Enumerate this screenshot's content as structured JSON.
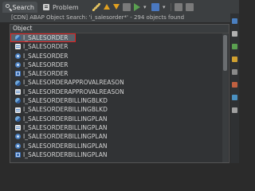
{
  "tabs": [
    {
      "label": "Search",
      "icon": "search-icon"
    },
    {
      "label": "Problem",
      "icon": "problem-icon"
    }
  ],
  "status_text": "[CDN] ABAP Object Search: 'i_salesorder*' - 294 objects found",
  "column_header": "Object",
  "rows": [
    {
      "label": "I_SALESORDER",
      "icon": "cds-view-icon",
      "selected": true
    },
    {
      "label": "I_SALESORDER",
      "icon": "ddl-source-icon"
    },
    {
      "label": "I_SALESORDER",
      "icon": "package-icon"
    },
    {
      "label": "I_SALESORDER",
      "icon": "package-icon"
    },
    {
      "label": "I_SALESORDER",
      "icon": "table-icon"
    },
    {
      "label": "I_SALESORDERAPPROVALREASON",
      "icon": "cds-view-icon"
    },
    {
      "label": "I_SALESORDERAPPROVALREASON",
      "icon": "ddl-source-icon"
    },
    {
      "label": "I_SALESORDERBILLINGBLKD",
      "icon": "cds-view-icon"
    },
    {
      "label": "I_SALESORDERBILLINGBLKD",
      "icon": "ddl-source-icon"
    },
    {
      "label": "I_SALESORDERBILLINGPLAN",
      "icon": "cds-view-icon"
    },
    {
      "label": "I_SALESORDERBILLINGPLAN",
      "icon": "ddl-source-icon"
    },
    {
      "label": "I_SALESORDERBILLINGPLAN",
      "icon": "package-icon"
    },
    {
      "label": "I_SALESORDERBILLINGPLAN",
      "icon": "package-icon"
    },
    {
      "label": "I_SALESORDERBILLINGPLAN",
      "icon": "table-icon"
    }
  ],
  "colors": {
    "selection_outline": "#e02020",
    "selection_bg": "#596169",
    "background": "#2b2b2b"
  }
}
